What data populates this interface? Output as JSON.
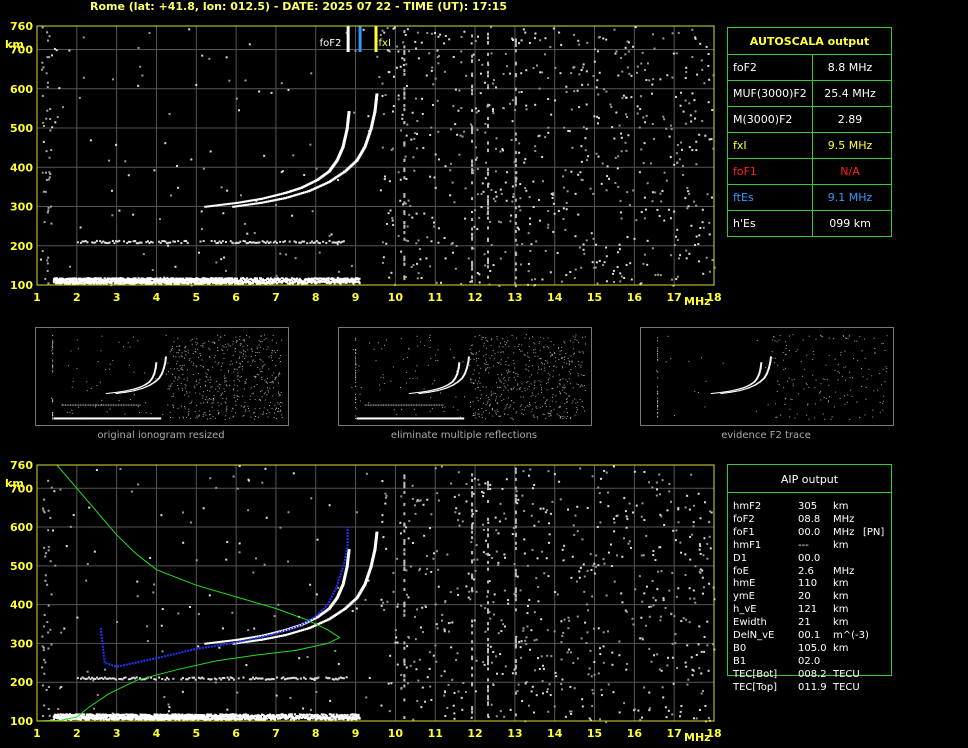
{
  "header": {
    "title": "Rome (lat: +41.8, lon: 012.5) - DATE: 2025 07 22 - TIME (UT): 17:15"
  },
  "autoscala": {
    "title": "AUTOSCALA output",
    "rows": [
      {
        "key": "foF2",
        "value": "8.8 MHz",
        "color": "#ffffff"
      },
      {
        "key": "MUF(3000)F2",
        "value": "25.4 MHz",
        "color": "#ffffff"
      },
      {
        "key": "M(3000)F2",
        "value": "2.89",
        "color": "#ffffff"
      },
      {
        "key": "fxI",
        "value": "9.5 MHz",
        "color": "#ffff33"
      },
      {
        "key": "foF1",
        "value": "N/A",
        "color": "#ff2020"
      },
      {
        "key": "ftEs",
        "value": "9.1 MHz",
        "color": "#3399ff"
      },
      {
        "key": "h'Es",
        "value": "099    km",
        "color": "#ffffff"
      }
    ]
  },
  "aip": {
    "title": "AIP output",
    "rows": [
      {
        "k": "hmF2",
        "v": "305",
        "u": "km",
        "x": ""
      },
      {
        "k": "foF2",
        "v": "08.8",
        "u": "MHz",
        "x": ""
      },
      {
        "k": "foF1",
        "v": "00.0",
        "u": "MHz",
        "x": "[PN]"
      },
      {
        "k": "hmF1",
        "v": "---",
        "u": "km",
        "x": ""
      },
      {
        "k": "D1",
        "v": "00.0",
        "u": "",
        "x": ""
      },
      {
        "k": "foE",
        "v": "2.6",
        "u": "MHz",
        "x": ""
      },
      {
        "k": "hmE",
        "v": "110",
        "u": "km",
        "x": ""
      },
      {
        "k": "ymE",
        "v": "20",
        "u": "km",
        "x": ""
      },
      {
        "k": "h_vE",
        "v": "121",
        "u": "km",
        "x": ""
      },
      {
        "k": "Ewidth",
        "v": "21",
        "u": "km",
        "x": ""
      },
      {
        "k": "DelN_vE",
        "v": "00.1",
        "u": "m^(-3)",
        "x": ""
      },
      {
        "k": "B0",
        "v": "105.0",
        "u": "km",
        "x": ""
      },
      {
        "k": "B1",
        "v": "02.0",
        "u": "",
        "x": ""
      },
      {
        "k": "TEC[Bot]",
        "v": "008.2",
        "u": "TECU",
        "x": ""
      },
      {
        "k": "TEC[Top]",
        "v": "011.9",
        "u": "TECU",
        "x": ""
      }
    ]
  },
  "thumbs": {
    "captions": [
      "original ionogram resized",
      "eliminate multiple reflections",
      "evidence F2 trace"
    ]
  },
  "chart_data": [
    {
      "type": "scatter",
      "xlabel": "MHz",
      "ylabel": "km",
      "xlim": [
        1,
        18
      ],
      "ylim": [
        100,
        760
      ],
      "xticks": [
        1,
        2,
        3,
        4,
        5,
        6,
        7,
        8,
        9,
        10,
        11,
        12,
        13,
        14,
        15,
        16,
        17,
        18
      ],
      "yticks": [
        100,
        200,
        300,
        400,
        500,
        600,
        700,
        760
      ],
      "grid": true,
      "markers": [
        {
          "label": "foF2",
          "freq": 8.8,
          "color": "#ffffff"
        },
        {
          "label": "",
          "freq": 9.1,
          "color": "#3399ff"
        },
        {
          "label": "fxI",
          "freq": 9.5,
          "color": "#ffff33"
        }
      ],
      "traces": {
        "o_mode": [
          [
            5.2,
            302
          ],
          [
            6.0,
            312
          ],
          [
            6.6,
            322
          ],
          [
            7.2,
            337
          ],
          [
            7.6,
            350
          ],
          [
            8.0,
            370
          ],
          [
            8.3,
            392
          ],
          [
            8.5,
            420
          ],
          [
            8.65,
            455
          ],
          [
            8.75,
            500
          ],
          [
            8.8,
            545
          ]
        ],
        "x_mode": [
          [
            5.9,
            302
          ],
          [
            6.6,
            312
          ],
          [
            7.2,
            324
          ],
          [
            7.8,
            342
          ],
          [
            8.3,
            365
          ],
          [
            8.7,
            392
          ],
          [
            9.0,
            420
          ],
          [
            9.2,
            455
          ],
          [
            9.35,
            500
          ],
          [
            9.45,
            545
          ],
          [
            9.5,
            590
          ]
        ],
        "es_band": {
          "fmin": 2.0,
          "fmax": 8.7,
          "h": 212
        },
        "e_band": {
          "fmin": 1.4,
          "fmax": 9.1,
          "h": 112
        }
      }
    },
    {
      "type": "scatter",
      "xlabel": "MHz",
      "ylabel": "km",
      "xlim": [
        1,
        18
      ],
      "ylim": [
        100,
        760
      ],
      "xticks": [
        1,
        2,
        3,
        4,
        5,
        6,
        7,
        8,
        9,
        10,
        11,
        12,
        13,
        14,
        15,
        16,
        17,
        18
      ],
      "yticks": [
        100,
        200,
        300,
        400,
        500,
        600,
        700,
        760
      ],
      "grid": true,
      "fit_blue": [
        [
          2.6,
          340
        ],
        [
          2.7,
          250
        ],
        [
          3.0,
          240
        ],
        [
          4.0,
          262
        ],
        [
          5.0,
          286
        ],
        [
          6.0,
          302
        ],
        [
          7.0,
          325
        ],
        [
          7.6,
          345
        ],
        [
          8.0,
          370
        ],
        [
          8.3,
          400
        ],
        [
          8.5,
          440
        ],
        [
          8.7,
          500
        ],
        [
          8.8,
          550
        ],
        [
          8.8,
          600
        ]
      ],
      "profile_green": [
        [
          1.5,
          760
        ],
        [
          2.0,
          700
        ],
        [
          2.5,
          640
        ],
        [
          3.0,
          580
        ],
        [
          3.5,
          530
        ],
        [
          4.0,
          490
        ],
        [
          5.0,
          450
        ],
        [
          6.0,
          420
        ],
        [
          7.0,
          390
        ],
        [
          7.8,
          360
        ],
        [
          8.3,
          335
        ],
        [
          8.6,
          315
        ],
        [
          8.3,
          300
        ],
        [
          7.5,
          282
        ],
        [
          6.5,
          270
        ],
        [
          5.5,
          255
        ],
        [
          4.5,
          232
        ],
        [
          3.5,
          205
        ],
        [
          2.8,
          170
        ],
        [
          2.3,
          135
        ],
        [
          2.0,
          110
        ],
        [
          1.6,
          102
        ],
        [
          1.0,
          100
        ]
      ],
      "traces": {
        "o_mode": [
          [
            5.2,
            302
          ],
          [
            6.0,
            312
          ],
          [
            6.6,
            322
          ],
          [
            7.2,
            337
          ],
          [
            7.6,
            350
          ],
          [
            8.0,
            370
          ],
          [
            8.3,
            392
          ],
          [
            8.5,
            420
          ],
          [
            8.65,
            455
          ],
          [
            8.75,
            500
          ],
          [
            8.8,
            545
          ]
        ],
        "x_mode": [
          [
            5.9,
            302
          ],
          [
            6.6,
            312
          ],
          [
            7.2,
            324
          ],
          [
            7.8,
            342
          ],
          [
            8.3,
            365
          ],
          [
            8.7,
            392
          ],
          [
            9.0,
            420
          ],
          [
            9.2,
            455
          ],
          [
            9.35,
            500
          ],
          [
            9.45,
            545
          ],
          [
            9.5,
            590
          ]
        ],
        "es_band": {
          "fmin": 2.0,
          "fmax": 8.7,
          "h": 212
        },
        "e_band": {
          "fmin": 1.4,
          "fmax": 9.1,
          "h": 112
        }
      }
    }
  ]
}
